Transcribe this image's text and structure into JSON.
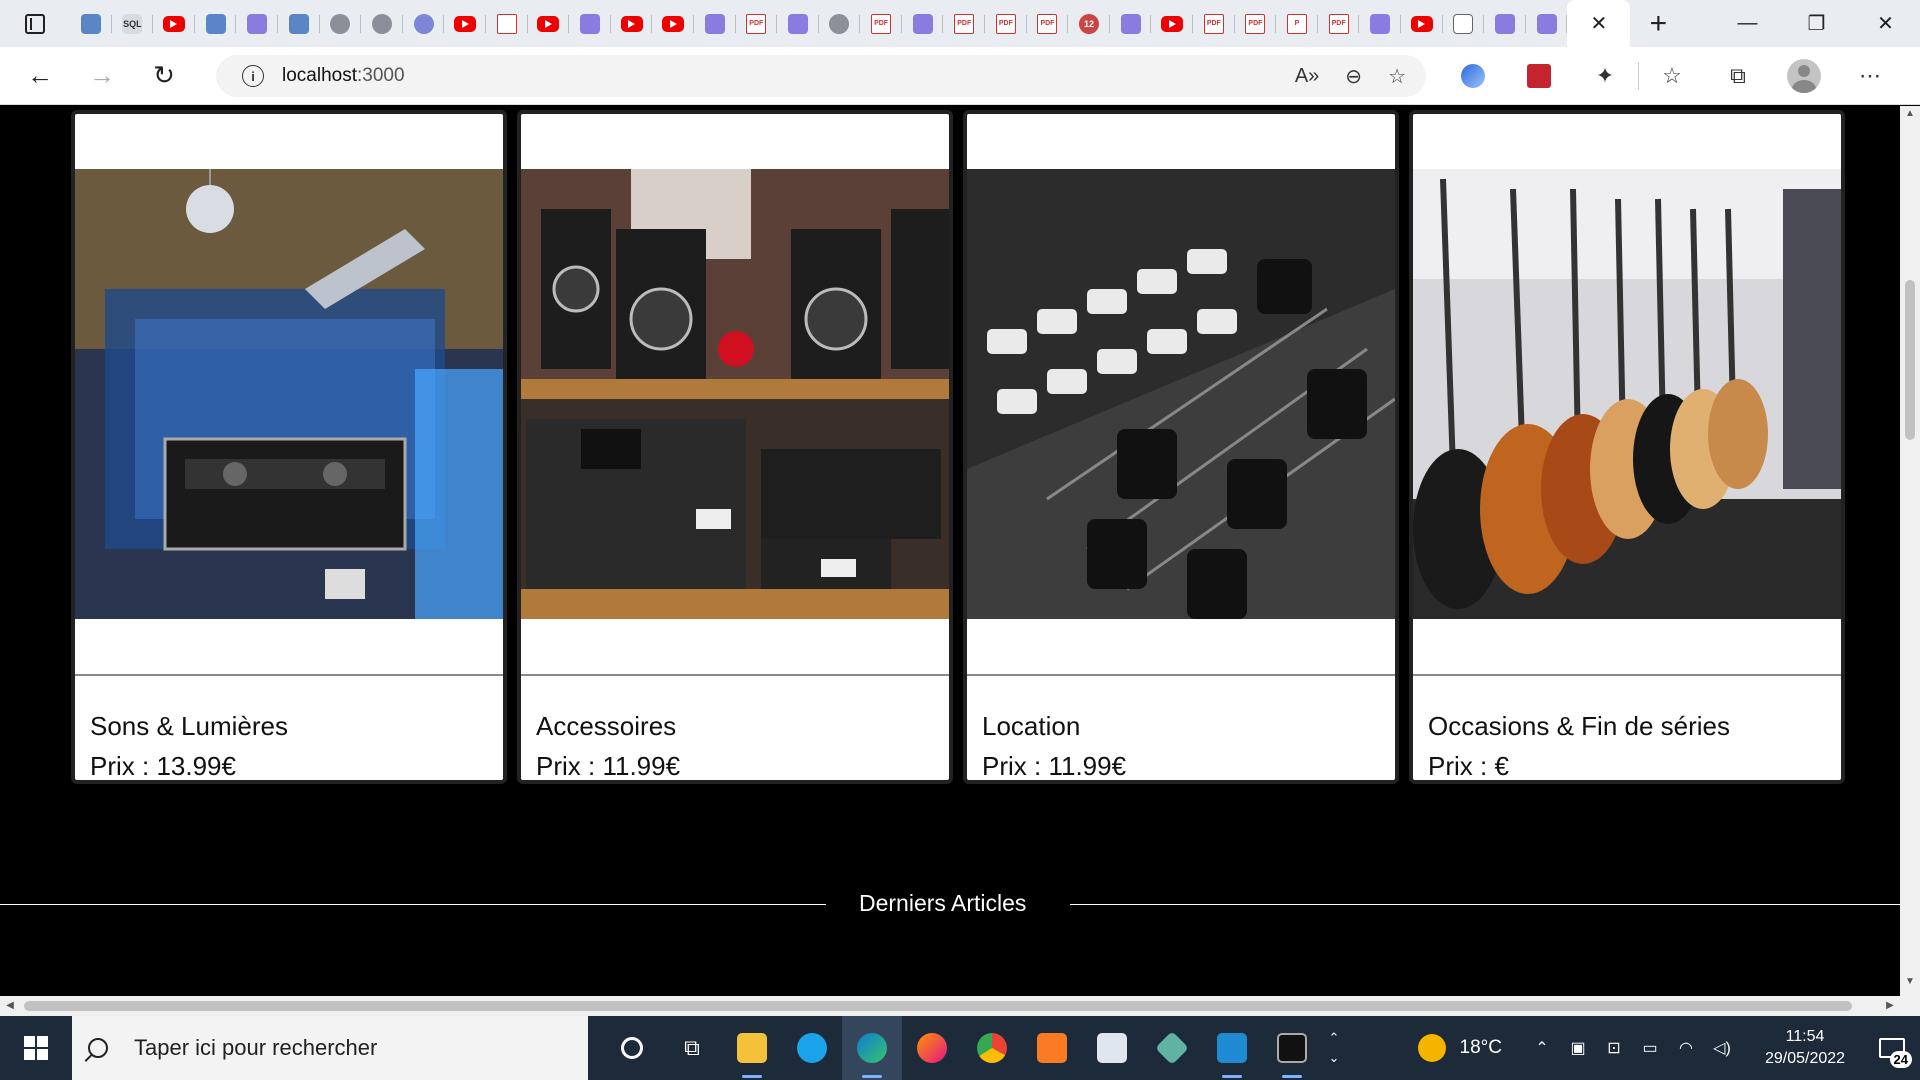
{
  "browser": {
    "tabs": [
      {
        "icon": "edge-icon"
      },
      {
        "icon": "sql-icon",
        "text": "SQL"
      },
      {
        "icon": "youtube-icon"
      },
      {
        "icon": "react-icon"
      },
      {
        "icon": "redux-icon"
      },
      {
        "icon": "react-icon"
      },
      {
        "icon": "gear-icon"
      },
      {
        "icon": "circle-icon"
      },
      {
        "icon": "discord-icon"
      },
      {
        "icon": "youtube-icon"
      },
      {
        "icon": "oval-icon"
      },
      {
        "icon": "youtube-icon"
      },
      {
        "icon": "redux-icon"
      },
      {
        "icon": "youtube-icon"
      },
      {
        "icon": "youtube-icon"
      },
      {
        "icon": "u-icon"
      },
      {
        "icon": "pdf-icon",
        "text": "PDF"
      },
      {
        "icon": "u-icon"
      },
      {
        "icon": "flag-icon"
      },
      {
        "icon": "pdf-icon",
        "text": "PDF"
      },
      {
        "icon": "u-icon"
      },
      {
        "icon": "pdf-icon",
        "text": "PDF"
      },
      {
        "icon": "pdf-icon",
        "text": "PDF"
      },
      {
        "icon": "pdf-icon",
        "text": "PDF"
      },
      {
        "icon": "twelve-icon",
        "text": "12"
      },
      {
        "icon": "u-icon"
      },
      {
        "icon": "youtube-icon"
      },
      {
        "icon": "pdf-icon",
        "text": "PDF"
      },
      {
        "icon": "pdf-icon",
        "text": "PDF"
      },
      {
        "icon": "p-icon",
        "text": "P"
      },
      {
        "icon": "pdf-icon",
        "text": "PDF"
      },
      {
        "icon": "hub-icon"
      },
      {
        "icon": "youtube-icon"
      },
      {
        "icon": "document-icon"
      },
      {
        "icon": "redux-icon"
      },
      {
        "icon": "redux-icon"
      }
    ],
    "url_host": "localhost",
    "url_port": ":3000"
  },
  "products": [
    {
      "title": "Sons & Lumières",
      "price": "Prix : 13.99€",
      "image": "dj-equipment-photo"
    },
    {
      "title": "Accessoires",
      "price": "Prix : 11.99€",
      "image": "studio-monitors-photo"
    },
    {
      "title": "Location",
      "price": "Prix : 11.99€",
      "image": "mixing-console-photo"
    },
    {
      "title": "Occasions & Fin de séries",
      "price": "Prix : €",
      "image": "guitars-photo"
    }
  ],
  "section": {
    "title": "Derniers Articles"
  },
  "taskbar": {
    "search_placeholder": "Taper ici pour rechercher",
    "weather_temp": "18°C",
    "time": "11:54",
    "date": "29/05/2022",
    "notification_count": "24"
  },
  "colors": {
    "page_background": "#000000",
    "card_background": "#ffffff",
    "taskbar_background": "#1d2a3a",
    "youtube_red": "#ee0000",
    "pdf_red": "#cc3333"
  }
}
